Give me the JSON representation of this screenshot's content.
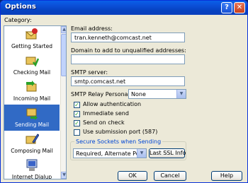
{
  "window": {
    "title": "Options",
    "help_glyph": "?",
    "close_glyph": "✕"
  },
  "category": {
    "label": "Category:",
    "items": [
      {
        "label": "Getting Started",
        "icon": "getting-started-icon"
      },
      {
        "label": "Checking Mail",
        "icon": "checking-mail-icon"
      },
      {
        "label": "Incoming Mail",
        "icon": "incoming-mail-icon"
      },
      {
        "label": "Sending Mail",
        "icon": "sending-mail-icon",
        "selected": true
      },
      {
        "label": "Composing Mail",
        "icon": "composing-mail-icon"
      },
      {
        "label": "Internet Dialup",
        "icon": "internet-dialup-icon"
      }
    ]
  },
  "form": {
    "email_label": "Email address:",
    "email_value": "tran.kenneth@comcast.net",
    "domain_label": "Domain to add to unqualified addresses:",
    "domain_value": "",
    "smtp_label": "SMTP server:",
    "smtp_value": "smtp.comcast.net",
    "relay_label": "SMTP Relay Personality:",
    "relay_value": "None",
    "checks": [
      {
        "label": "Allow authentication",
        "checked": true
      },
      {
        "label": "Immediate send",
        "checked": true
      },
      {
        "label": "Send on check",
        "checked": true
      },
      {
        "label": "Use submission port (587)",
        "checked": false
      }
    ],
    "secure_title": "Secure Sockets when Sending",
    "secure_value": "Required, Alternate Port",
    "last_ssl_label": "Last SSL Info"
  },
  "buttons": {
    "ok": "OK",
    "cancel": "Cancel",
    "help": "Help"
  },
  "colors": {
    "title_bar": "#0a5fe8",
    "selection": "#316ac5",
    "dialog_bg": "#ece9d8",
    "group_title": "#0046d5"
  }
}
